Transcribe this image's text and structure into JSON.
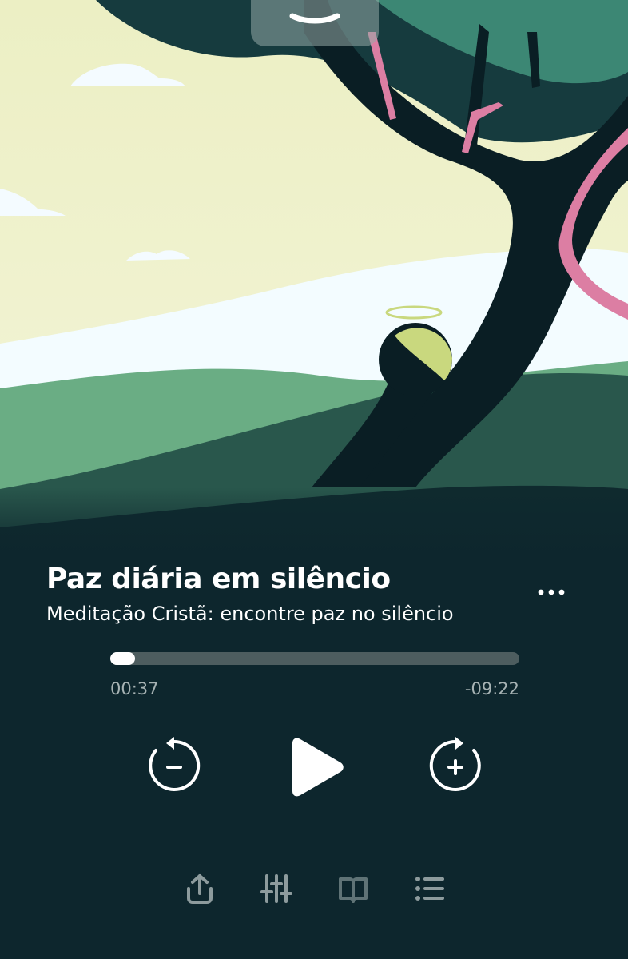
{
  "player": {
    "title": "Paz diária em silêncio",
    "subtitle": "Meditação Cristã: encontre paz no silêncio",
    "progress_fraction": 0.06,
    "time_elapsed": "00:37",
    "time_remaining": "-09:22"
  },
  "icons": {
    "collapse": "chevron-down-icon",
    "more": "more-horizontal-icon",
    "rewind": "rewind-icon",
    "play": "play-icon",
    "forward": "forward-icon",
    "share": "share-icon",
    "equalizer": "sliders-icon",
    "book": "book-icon",
    "list": "list-icon"
  },
  "colors": {
    "background": "#0d262d",
    "progress_track": "#4d5d5f",
    "progress_fill": "#ffffff",
    "time_text": "#a7b3b4",
    "icon_dim": "#8d9b9d"
  }
}
